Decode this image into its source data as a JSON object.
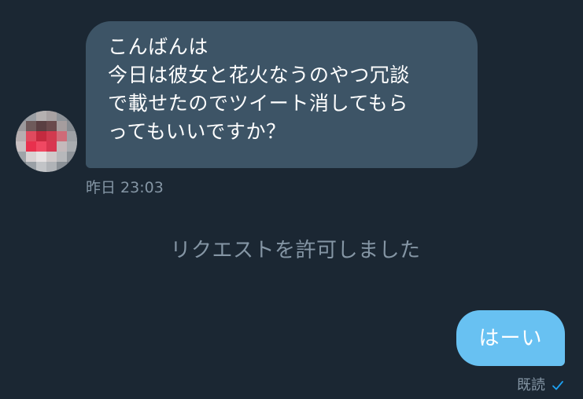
{
  "conversation": {
    "incoming_message": {
      "lines": [
        "こんばんは",
        "今日は彼女と花火なうのやつ冗談",
        "で載せたのでツイート消してもら",
        "ってもいいですか？"
      ],
      "timestamp": "昨日 23:03"
    },
    "system_note": "リクエストを許可しました",
    "outgoing_message": {
      "text": "はーい",
      "status": "既読"
    }
  },
  "colors": {
    "background": "#1b2733",
    "incoming_bubble": "#3d5466",
    "outgoing_bubble": "#68c1f2",
    "muted_text": "#8596a5",
    "check_icon": "#1da1f2"
  },
  "icons": {
    "read_check": "check-icon",
    "avatar": "pixelated-avatar"
  }
}
